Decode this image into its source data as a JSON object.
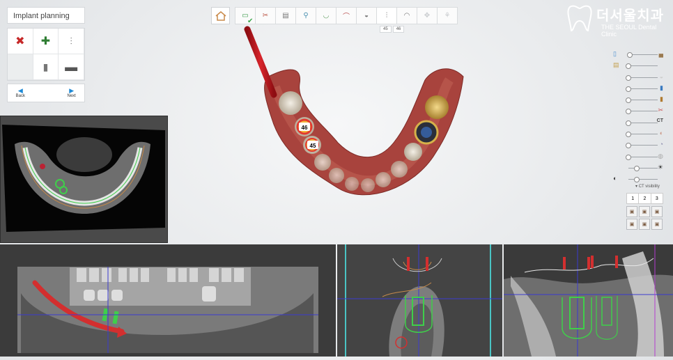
{
  "panel": {
    "title": "Implant planning"
  },
  "tools": [
    {
      "icon": "delete-x-icon",
      "glyph": "✖",
      "color": "#c62828"
    },
    {
      "icon": "add-plus-icon",
      "glyph": "✚",
      "color": "#2e7d32"
    },
    {
      "icon": "implant-icon",
      "glyph": "⫶",
      "color": "#666666"
    },
    {
      "icon": "empty",
      "glyph": "",
      "color": "#666666"
    },
    {
      "icon": "abutment-icon",
      "glyph": "▮",
      "color": "#666666"
    },
    {
      "icon": "sleeve-icon",
      "glyph": "▬",
      "color": "#555555"
    }
  ],
  "nav": {
    "back": "Back",
    "next": "Next"
  },
  "toolbar": {
    "home_icon": "home-icon",
    "steps": [
      "scan-icon",
      "extract-icon",
      "ct-icon",
      "align-icon",
      "arch-icon",
      "gingiva-icon",
      "crown-icon",
      "implant-icon",
      "sleeve-icon",
      "guide-icon",
      "export-icon"
    ],
    "tooth_tabs": [
      "45",
      "46"
    ]
  },
  "logo": {
    "korean": "더서울치과",
    "english": "THE SEOUL Dental Clinic"
  },
  "tooth_labels": [
    "46",
    "45"
  ],
  "visibility": {
    "sliders": [
      "scan",
      "crown",
      "gingiva",
      "implant",
      "sleeve",
      "guide",
      "CT",
      "tooth",
      "tooth2",
      "tooth3",
      "brightness",
      "contrast"
    ],
    "ct_label": "CT",
    "ct_visibility": "CT visibility",
    "views": [
      "1",
      "2",
      "3"
    ]
  },
  "colors": {
    "implant": "#3fcf4a",
    "accent": "#1f8ad6",
    "sleeve": "#d32f2f"
  }
}
